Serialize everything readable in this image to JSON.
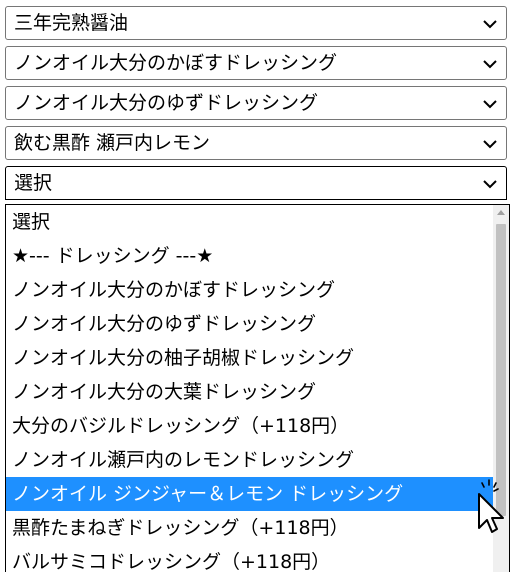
{
  "selects": [
    {
      "value": "三年完熟醤油"
    },
    {
      "value": "ノンオイル大分のかぼすドレッシング"
    },
    {
      "value": "ノンオイル大分のゆずドレッシング"
    },
    {
      "value": "飲む黒酢 瀬戸内レモン"
    },
    {
      "value": "選択"
    }
  ],
  "dropdown": {
    "options": [
      "選択",
      "★--- ドレッシング ---★",
      "ノンオイル大分のかぼすドレッシング",
      "ノンオイル大分のゆずドレッシング",
      "ノンオイル大分の柚子胡椒ドレッシング",
      "ノンオイル大分の大葉ドレッシング",
      "大分のバジルドレッシング（+118円）",
      "ノンオイル瀬戸内のレモンドレッシング",
      "ノンオイル ジンジャー＆レモン ドレッシング",
      "黒酢たまねぎドレッシング（+118円）",
      "バルサミコドレッシング（+118円）"
    ],
    "highlighted_index": 8
  },
  "colors": {
    "highlight": "#1e90ff",
    "border": "#767676",
    "scroll_thumb": "#c1c1c1",
    "scroll_track": "#f0f0f0"
  },
  "icons": {
    "select_arrow": "chevron-down-icon",
    "scroll_up": "triangle-up-icon",
    "cursor": "mouse-pointer-icon"
  }
}
